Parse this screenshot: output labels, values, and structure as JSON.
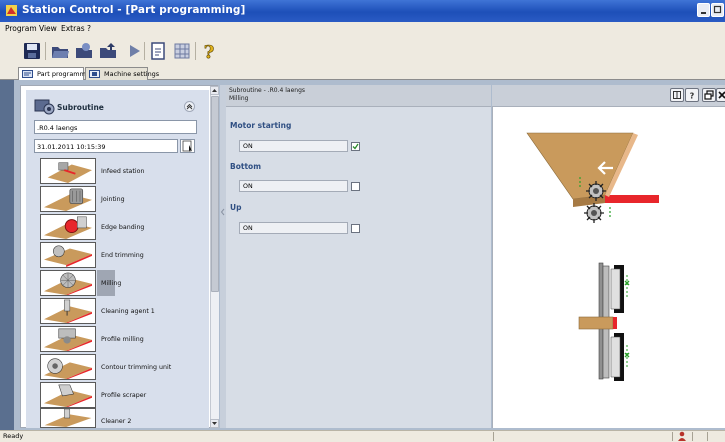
{
  "window": {
    "title": "Station Control - [Part programming]"
  },
  "menu": [
    "Program",
    "View",
    "Extras",
    "?"
  ],
  "toolbar": {
    "buttons": [
      "save-icon",
      "open-folder-icon",
      "export-icon",
      "import-icon",
      "play-icon",
      "document-icon",
      "grid-icon",
      "help-icon"
    ]
  },
  "tabs": [
    {
      "label": "Part programming",
      "active": true
    },
    {
      "label": "Machine settings",
      "active": false
    }
  ],
  "subroutine": {
    "title": "Subroutine",
    "name_value": ".R0.4 laengs",
    "date_value": "31.01.2011 10:15:39",
    "items": [
      {
        "label": "Infeed station",
        "selected": false
      },
      {
        "label": "Jointing",
        "selected": false
      },
      {
        "label": "Edge banding",
        "selected": false
      },
      {
        "label": "End trimming",
        "selected": false
      },
      {
        "label": "Milling",
        "selected": true
      },
      {
        "label": "Cleaning agent 1",
        "selected": false
      },
      {
        "label": "Profile milling",
        "selected": false
      },
      {
        "label": "Contour trimming unit",
        "selected": false
      },
      {
        "label": "Profile scraper",
        "selected": false
      },
      {
        "label": "Cleaner 2",
        "selected": false
      }
    ]
  },
  "detail": {
    "header_line1": "Subroutine - .R0.4 laengs",
    "header_line2": "Milling",
    "sections": [
      {
        "title": "Motor starting",
        "value": "ON",
        "checked": true
      },
      {
        "title": "Bottom",
        "value": "ON",
        "checked": false
      },
      {
        "title": "Up",
        "value": "ON",
        "checked": false
      }
    ]
  },
  "colors": {
    "title_bar": "#2a5bc4",
    "section_title": "#2f4f83",
    "edge_red": "#e8262b",
    "wood": "#c99a5c"
  },
  "status": {
    "text": "Ready"
  }
}
